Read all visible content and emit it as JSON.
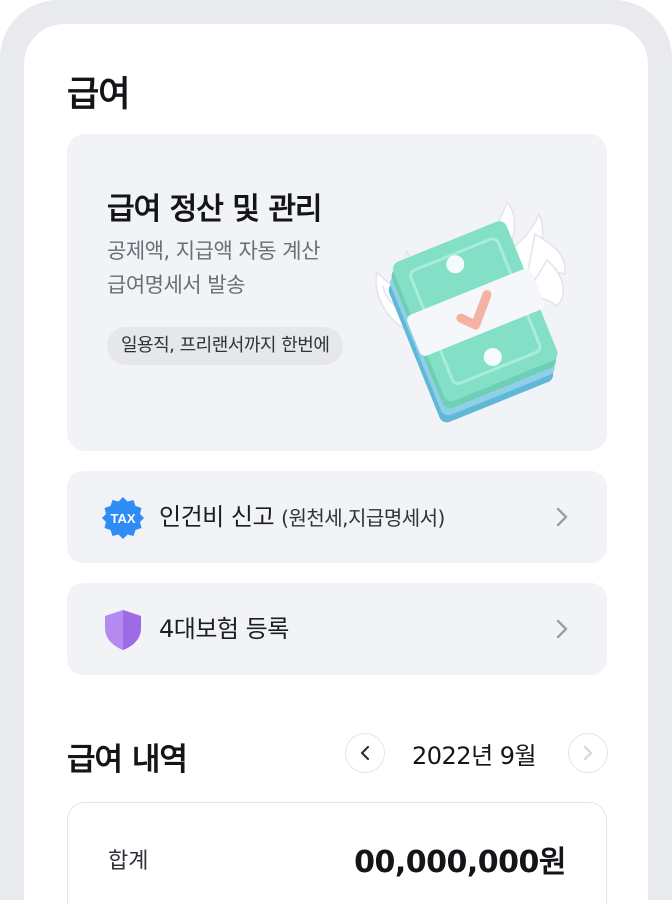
{
  "page": {
    "title": "급여"
  },
  "hero": {
    "title": "급여 정산 및 관리",
    "subtitle_line1": "공제액, 지급액 자동 계산",
    "subtitle_line2": "급여명세서 발송",
    "chip": "일용직, 프리랜서까지 한번에"
  },
  "menu": [
    {
      "label": "인건비 신고",
      "extra": "(원천세,지급명세서)",
      "icon": "tax-badge-icon",
      "icon_text": "TAX",
      "icon_color": "#2f8cf4"
    },
    {
      "label": "4대보험 등록",
      "extra": "",
      "icon": "shield-icon",
      "icon_color": "#b48af0"
    }
  ],
  "history": {
    "title": "급여 내역",
    "month": "2022년 9월",
    "summary_label": "합계",
    "summary_amount": "00,000,000원"
  },
  "colors": {
    "card_bg": "#f2f3f6",
    "frame": "#e9eaee",
    "money_green": "#7fdcc4",
    "check_pink": "#f5b7a9"
  }
}
